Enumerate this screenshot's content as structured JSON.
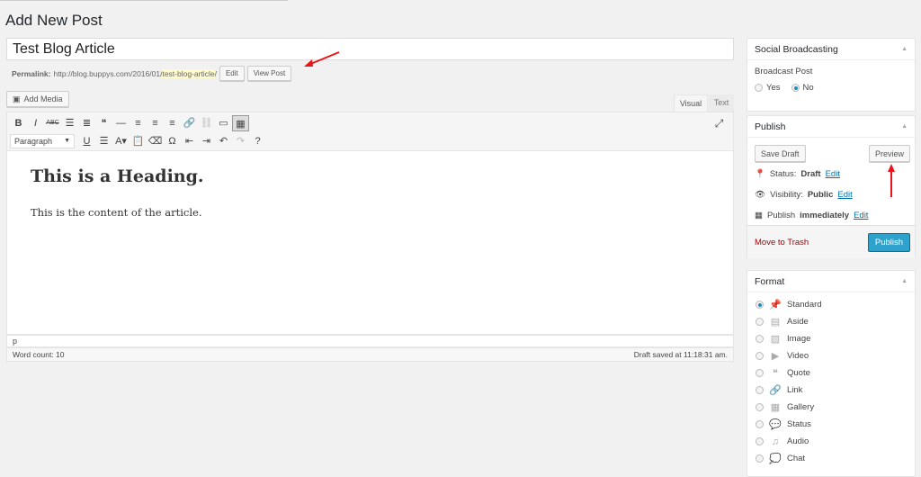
{
  "page": {
    "title": "Add New Post"
  },
  "post": {
    "title": "Test Blog Article",
    "permalink": {
      "label": "Permalink:",
      "base": "http://blog.buppys.com/2016/01/",
      "slug": "test-blog-article",
      "trail": "/",
      "edit": "Edit",
      "view": "View Post"
    }
  },
  "editor": {
    "add_media": "Add Media",
    "tabs": {
      "visual": "Visual",
      "text": "Text"
    },
    "format_select": "Paragraph",
    "toolbar_row1": [
      {
        "name": "bold",
        "g": "B"
      },
      {
        "name": "italic",
        "g": "I"
      },
      {
        "name": "strikethrough",
        "g": "ABC"
      },
      {
        "name": "bulleted-list",
        "g": "☰"
      },
      {
        "name": "numbered-list",
        "g": "≣"
      },
      {
        "name": "blockquote",
        "g": "❝"
      },
      {
        "name": "horizontal-line",
        "g": "—"
      },
      {
        "name": "align-left",
        "g": "≡"
      },
      {
        "name": "align-center",
        "g": "≡"
      },
      {
        "name": "align-right",
        "g": "≡"
      },
      {
        "name": "insert-link",
        "g": "🔗"
      },
      {
        "name": "unlink",
        "g": "⛓"
      },
      {
        "name": "read-more",
        "g": "▭"
      },
      {
        "name": "toolbar-toggle",
        "g": "▦"
      }
    ],
    "toolbar_row2": [
      {
        "name": "underline",
        "g": "U"
      },
      {
        "name": "justify",
        "g": "☰"
      },
      {
        "name": "text-color",
        "g": "A▾"
      },
      {
        "name": "paste-as-text",
        "g": "📋"
      },
      {
        "name": "clear-formatting",
        "g": "⌫"
      },
      {
        "name": "special-character",
        "g": "Ω"
      },
      {
        "name": "outdent",
        "g": "⇤"
      },
      {
        "name": "indent",
        "g": "⇥"
      },
      {
        "name": "undo",
        "g": "↶"
      },
      {
        "name": "redo",
        "g": "↷"
      },
      {
        "name": "help",
        "g": "?"
      }
    ],
    "content": {
      "heading": "This is a Heading.",
      "paragraph": "This is the content of the article."
    },
    "path": "p",
    "word_count": "Word count: 10",
    "draft_saved": "Draft saved at 11:18:31 am."
  },
  "social": {
    "title": "Social Broadcasting",
    "label": "Broadcast Post",
    "options": [
      "Yes",
      "No"
    ],
    "selected": "No"
  },
  "publish": {
    "title": "Publish",
    "save_draft": "Save Draft",
    "preview": "Preview",
    "status_label": "Status:",
    "status": "Draft",
    "visibility_label": "Visibility:",
    "visibility": "Public",
    "schedule_label": "Publish",
    "schedule": "immediately",
    "edit": "Edit",
    "trash": "Move to Trash",
    "publish": "Publish"
  },
  "format": {
    "title": "Format",
    "selected": "Standard",
    "options": [
      {
        "label": "Standard",
        "icon": "pin"
      },
      {
        "label": "Aside",
        "icon": "aside"
      },
      {
        "label": "Image",
        "icon": "image"
      },
      {
        "label": "Video",
        "icon": "video"
      },
      {
        "label": "Quote",
        "icon": "quote"
      },
      {
        "label": "Link",
        "icon": "link"
      },
      {
        "label": "Gallery",
        "icon": "gallery"
      },
      {
        "label": "Status",
        "icon": "status"
      },
      {
        "label": "Audio",
        "icon": "audio"
      },
      {
        "label": "Chat",
        "icon": "chat"
      }
    ]
  },
  "colors": {
    "accent": "#0073aa",
    "publish_button": "#2ea2cc",
    "trash": "#a00",
    "annotation_arrow": "#e8141a"
  }
}
